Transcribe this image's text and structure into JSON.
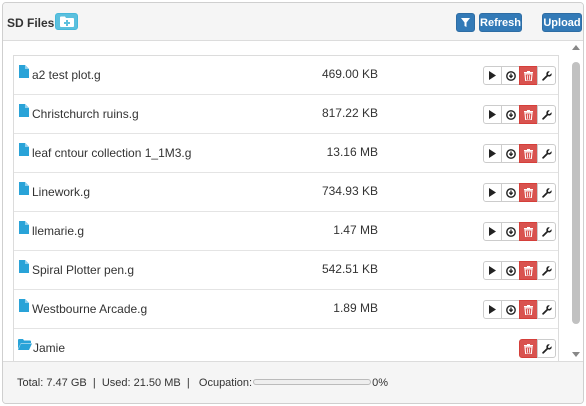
{
  "header": {
    "title": "SD Files",
    "refresh_label": "Refresh",
    "upload_label": "Upload"
  },
  "files": [
    {
      "name": "a2 test plot.g",
      "size": "469.00 KB"
    },
    {
      "name": "Christchurch ruins.g",
      "size": "817.22 KB"
    },
    {
      "name": "leaf cntour collection 1_1M3.g",
      "size": "13.16 MB"
    },
    {
      "name": "Linework.g",
      "size": "734.93 KB"
    },
    {
      "name": "llemarie.g",
      "size": "1.47 MB"
    },
    {
      "name": "Spiral Plotter pen.g",
      "size": "542.51 KB"
    },
    {
      "name": "Westbourne Arcade.g",
      "size": "1.89 MB"
    }
  ],
  "folders": [
    {
      "name": "Jamie"
    }
  ],
  "footer": {
    "total_label": "Total:",
    "total": "7.47 GB",
    "used_label": "Used:",
    "used": "21.50 MB",
    "occupation_label": "Ocupation:",
    "occupation": "0%",
    "occupation_fraction": 0
  },
  "colors": {
    "primary": "#337ab7",
    "info": "#5bc0de",
    "danger": "#d9534f",
    "file_icon": "#29a3d8"
  },
  "icons": {
    "file": "file-icon",
    "folder": "folder-open-icon",
    "play": "play-icon",
    "download": "download-icon",
    "delete": "trash-icon",
    "settings": "wrench-icon",
    "filter": "filter-icon",
    "new_folder": "folder-plus-icon"
  }
}
